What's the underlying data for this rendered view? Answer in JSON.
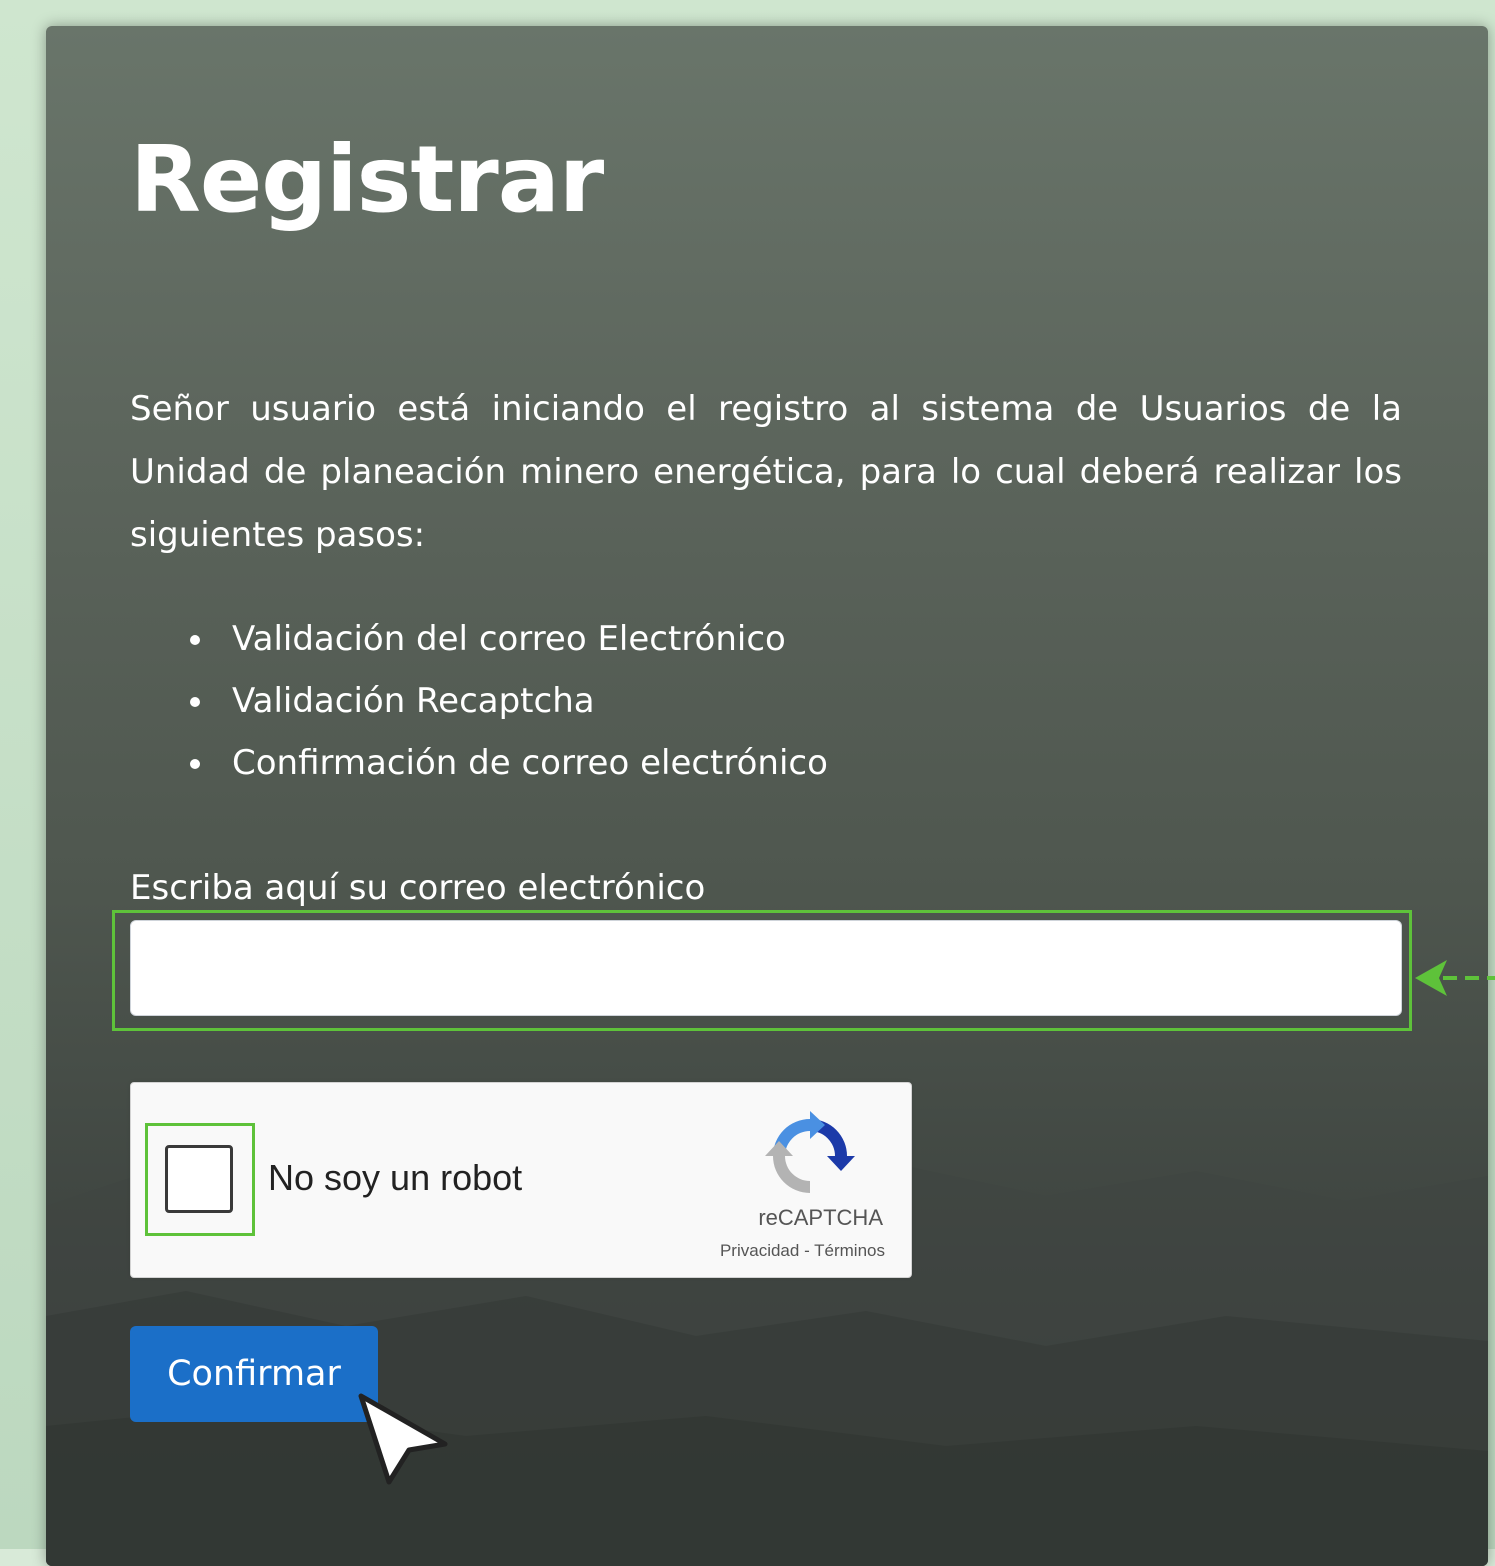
{
  "form": {
    "title": "Registrar",
    "intro": "Señor usuario está iniciando el registro al sistema de Usuarios de la Unidad de planeación minero energética, para lo cual deberá realizar los siguientes pasos:",
    "steps": [
      "Validación del correo Electrónico",
      "Validación Recaptcha",
      "Confirmación de correo electrónico"
    ],
    "email_label": "Escriba aquí su correo electrónico",
    "email_value": "",
    "confirm_label": "Confirmar"
  },
  "recaptcha": {
    "checkbox_label": "No soy un robot",
    "brand": "reCAPTCHA",
    "links": "Privacidad - Términos",
    "icon": "recaptcha-logo-icon"
  },
  "annotations": {
    "highlight_color": "#5ec23a",
    "arrow_icon": "arrow-left-icon",
    "cursor_icon": "mouse-pointer-icon"
  },
  "colors": {
    "button": "#1b6fc8",
    "card_background": "#5d665d"
  }
}
